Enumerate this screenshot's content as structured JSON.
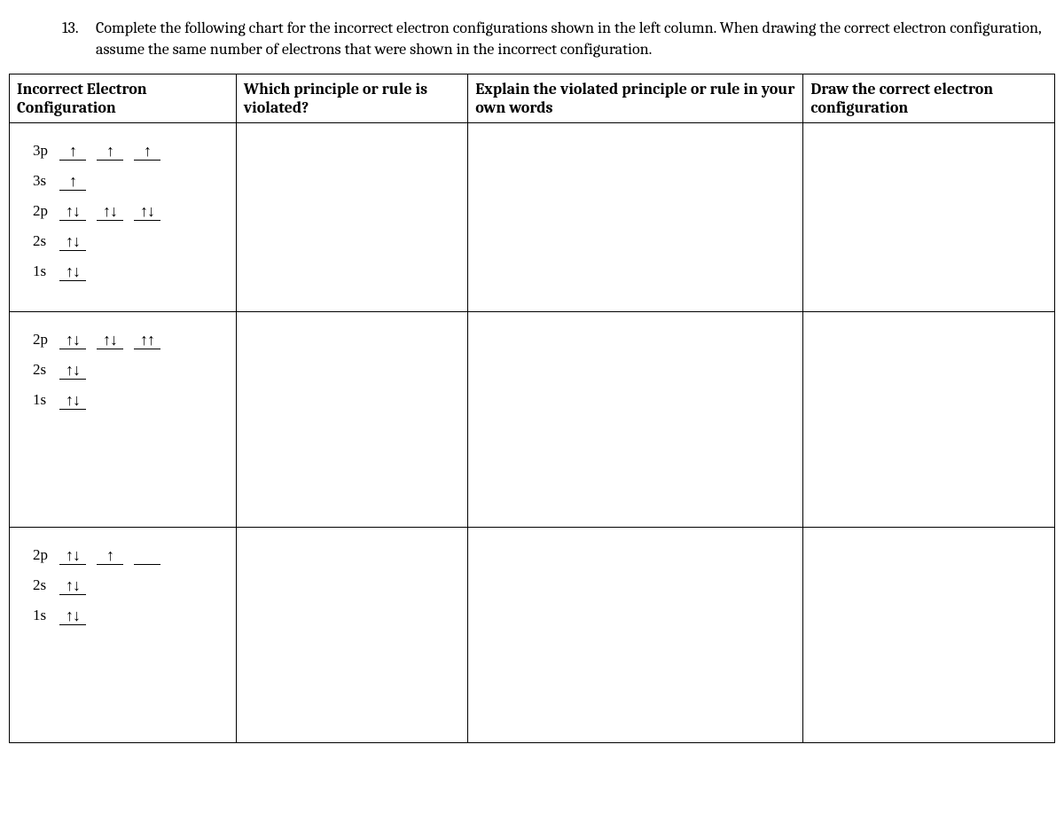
{
  "question": {
    "number": "13.",
    "text": "Complete the following chart for the incorrect electron configurations shown in the left column. When drawing the correct electron configuration, assume the same number of electrons that were shown in the incorrect configuration."
  },
  "headers": {
    "col1": "Incorrect Electron Configuration",
    "col2": "Which principle or rule is violated?",
    "col3": "Explain the violated principle or rule in your own words",
    "col4": "Draw the correct electron configuration"
  },
  "rows": [
    {
      "orbitals": [
        {
          "label": "3p",
          "boxes": [
            "↑",
            "↑",
            "↑"
          ]
        },
        {
          "label": "3s",
          "boxes": [
            "↑"
          ]
        },
        {
          "label": "2p",
          "boxes": [
            "↑↓",
            "↑↓",
            "↑↓"
          ]
        },
        {
          "label": "2s",
          "boxes": [
            "↑↓"
          ]
        },
        {
          "label": "1s",
          "boxes": [
            "↑↓"
          ]
        }
      ]
    },
    {
      "orbitals": [
        {
          "label": "2p",
          "boxes": [
            "↑↓",
            "↑↓",
            "↑↑"
          ]
        },
        {
          "label": "2s",
          "boxes": [
            "↑↓"
          ]
        },
        {
          "label": "1s",
          "boxes": [
            "↑↓"
          ]
        }
      ]
    },
    {
      "orbitals": [
        {
          "label": "2p",
          "boxes": [
            "↑↓",
            "↑",
            ""
          ]
        },
        {
          "label": "2s",
          "boxes": [
            "↑↓"
          ]
        },
        {
          "label": "1s",
          "boxes": [
            "↑↓"
          ]
        }
      ]
    }
  ]
}
